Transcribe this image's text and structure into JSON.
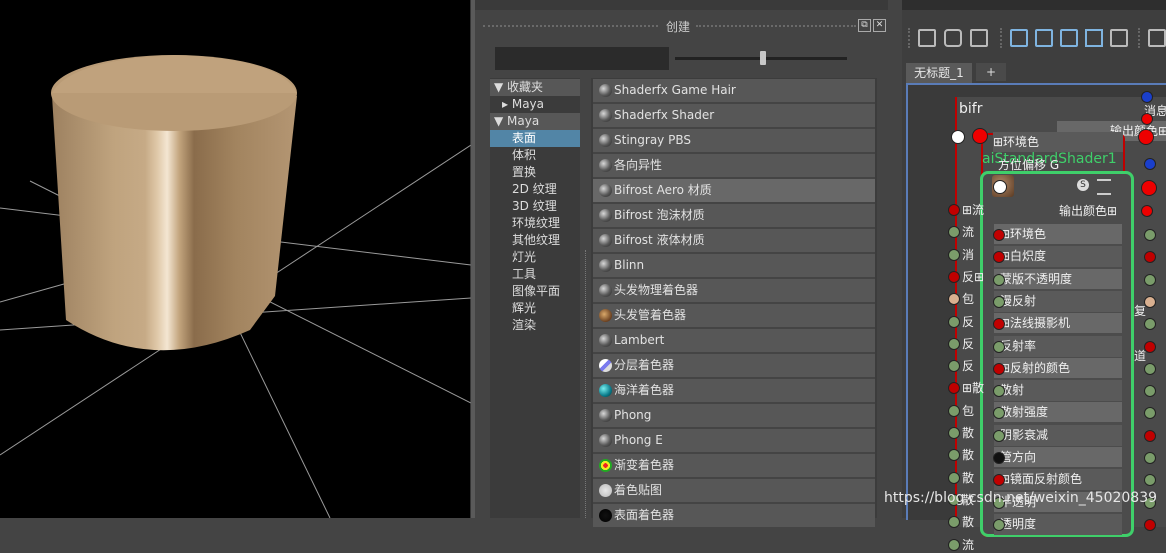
{
  "create_panel": {
    "title": "创建",
    "search_placeholder": "",
    "slider_value": 0.52,
    "categories": [
      {
        "label": "▼ 收藏夹",
        "kind": "header"
      },
      {
        "label": "▸ Maya",
        "kind": "sub"
      },
      {
        "label": "▼ Maya",
        "kind": "header"
      },
      {
        "label": "表面",
        "kind": "selected"
      },
      {
        "label": "体积",
        "kind": "item"
      },
      {
        "label": "置换",
        "kind": "item"
      },
      {
        "label": "2D 纹理",
        "kind": "item"
      },
      {
        "label": "3D 纹理",
        "kind": "item"
      },
      {
        "label": "环境纹理",
        "kind": "item"
      },
      {
        "label": "其他纹理",
        "kind": "item"
      },
      {
        "label": "灯光",
        "kind": "item"
      },
      {
        "label": "工具",
        "kind": "item"
      },
      {
        "label": "图像平面",
        "kind": "item"
      },
      {
        "label": "辉光",
        "kind": "item"
      },
      {
        "label": "渲染",
        "kind": "item"
      }
    ],
    "shaders": [
      {
        "label": "Shaderfx Game Hair",
        "icon": "sphere-icon"
      },
      {
        "label": "Shaderfx Shader",
        "icon": "sphere-icon"
      },
      {
        "label": "Stingray PBS",
        "icon": "sphere-icon"
      },
      {
        "label": "各向异性",
        "icon": "sphere-icon"
      },
      {
        "label": "Bifrost Aero 材质",
        "icon": "sphere-icon"
      },
      {
        "label": "Bifrost 泡沫材质",
        "icon": "sphere-icon"
      },
      {
        "label": "Bifrost 液体材质",
        "icon": "sphere-icon"
      },
      {
        "label": "Blinn",
        "icon": "sphere-icon"
      },
      {
        "label": "头发物理着色器",
        "icon": "sphere-icon"
      },
      {
        "label": "头发管着色器",
        "icon": "hair-tube-icon"
      },
      {
        "label": "Lambert",
        "icon": "sphere-icon"
      },
      {
        "label": "分层着色器",
        "icon": "layered-icon"
      },
      {
        "label": "海洋着色器",
        "icon": "ocean-icon"
      },
      {
        "label": "Phong",
        "icon": "sphere-icon"
      },
      {
        "label": "Phong E",
        "icon": "sphere-icon"
      },
      {
        "label": "渐变着色器",
        "icon": "ramp-icon"
      },
      {
        "label": "着色贴图",
        "icon": "shading-map-icon"
      },
      {
        "label": "表面着色器",
        "icon": "surface-icon"
      }
    ],
    "highlighted_shader": "Bifrost Aero 材质"
  },
  "node_editor": {
    "tab_label": "无标题_1",
    "tab_add": "+",
    "back_node": {
      "title_fragment": "bifr",
      "rows_right": [
        "消息",
        "输出颜色⊞"
      ],
      "left_fragments": [
        "⊞流",
        "流",
        "消",
        "反⊞",
        "包",
        "反",
        "反",
        "反",
        "⊞散",
        "包",
        "散",
        "散",
        "散",
        "散",
        "散",
        "流"
      ],
      "right_fragments": [
        "复",
        "道"
      ]
    },
    "front_node": {
      "title": "aiStandardShader1",
      "title_overlay": "方位偏移 G",
      "output_label": "输出颜色⊞",
      "attributes": [
        {
          "label": "⊞环境色",
          "port": "#c00000"
        },
        {
          "label": "⊞白炽度",
          "port": "#c00000"
        },
        {
          "label": "蒙版不透明度",
          "port": "#7a9c6a"
        },
        {
          "label": "漫反射",
          "port": "#7a9c6a"
        },
        {
          "label": "⊞法线摄影机",
          "port": "#c00000"
        },
        {
          "label": "反射率",
          "port": "#7a9c6a"
        },
        {
          "label": "⊞反射的颜色",
          "port": "#c00000"
        },
        {
          "label": "散射",
          "port": "#7a9c6a"
        },
        {
          "label": "散射强度",
          "port": "#7a9c6a"
        },
        {
          "label": "阴影衰减",
          "port": "#7a9c6a"
        },
        {
          "label": "管方向",
          "port": "#111111"
        },
        {
          "label": "⊞镜面反射颜色",
          "port": "#c00000"
        },
        {
          "label": "半透明",
          "port": "#7a9c6a"
        },
        {
          "label": "透明度",
          "port": "#7a9c6a"
        }
      ],
      "top_label": "⊞环境色"
    }
  },
  "watermark": "https://blog.csdn.net/weixin_45020839",
  "colors": {
    "selection": "#5285a6",
    "node_outline": "#3fcf6a",
    "port_red": "#c00000",
    "port_green": "#7a9c6a",
    "port_blue": "#1a3fcc",
    "grid_line": "#c8c8c8"
  }
}
